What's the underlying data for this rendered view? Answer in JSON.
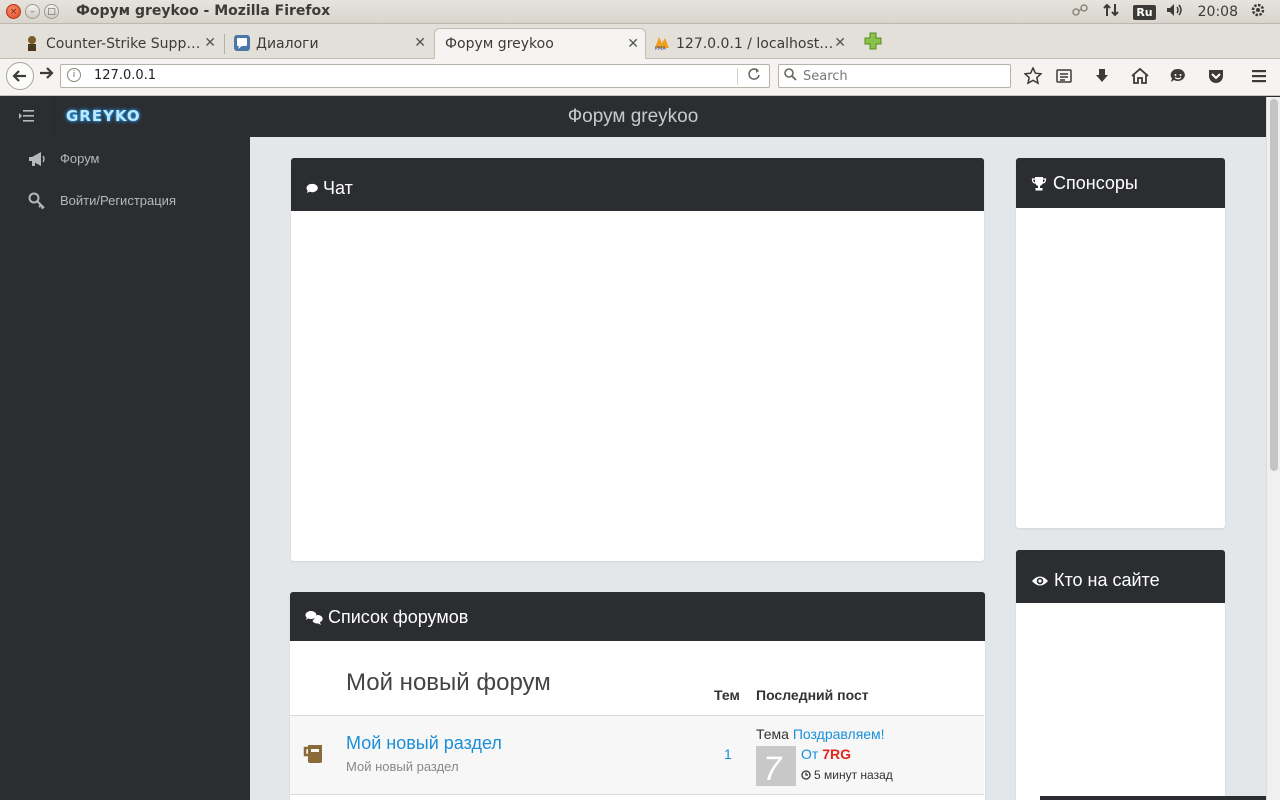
{
  "window": {
    "title": "Форум greykoo - Mozilla Firefox",
    "tray": {
      "keyboard_layout": "Ru",
      "time": "20:08"
    }
  },
  "tabs": [
    {
      "label": "Counter-Strike Supp…",
      "favicon": "cs-favicon"
    },
    {
      "label": "Диалоги",
      "favicon": "vk-favicon"
    },
    {
      "label": "Форум greykoo",
      "active": true
    },
    {
      "label": "127.0.0.1 / localhost…",
      "favicon": "pma-favicon"
    }
  ],
  "navbar": {
    "url": "127.0.0.1",
    "search_placeholder": "Search"
  },
  "sidebar": {
    "brand": "GREYKO",
    "items": [
      {
        "label": "Форум",
        "icon": "megaphone-icon"
      },
      {
        "label": "Войти/Регистрация",
        "icon": "key-icon"
      }
    ]
  },
  "header": {
    "title": "Форум greykoo"
  },
  "chat": {
    "title": "Чат",
    "icon": "comment-icon"
  },
  "forums": {
    "title": "Список форумов",
    "icon": "comments-icon",
    "group_title": "Мой новый форум",
    "col_topics": "Тем",
    "col_last_post": "Последний пост",
    "rows": [
      {
        "title": "Мой новый раздел",
        "subtitle": "Мой новый раздел",
        "topics": "1",
        "last_post": {
          "theme_prefix": "Тема",
          "theme_link": "Поздравляем!",
          "from_prefix": "От",
          "user": "7RG",
          "time": "5 минут назад"
        }
      }
    ]
  },
  "sponsors": {
    "title": "Спонсоры",
    "icon": "trophy-icon"
  },
  "online": {
    "title": "Кто на сайте",
    "icon": "eye-icon"
  },
  "colors": {
    "dark": "#2b2d31",
    "link": "#1a8fd8",
    "user": "#e3241b",
    "page_bg": "#e4e7ea"
  }
}
